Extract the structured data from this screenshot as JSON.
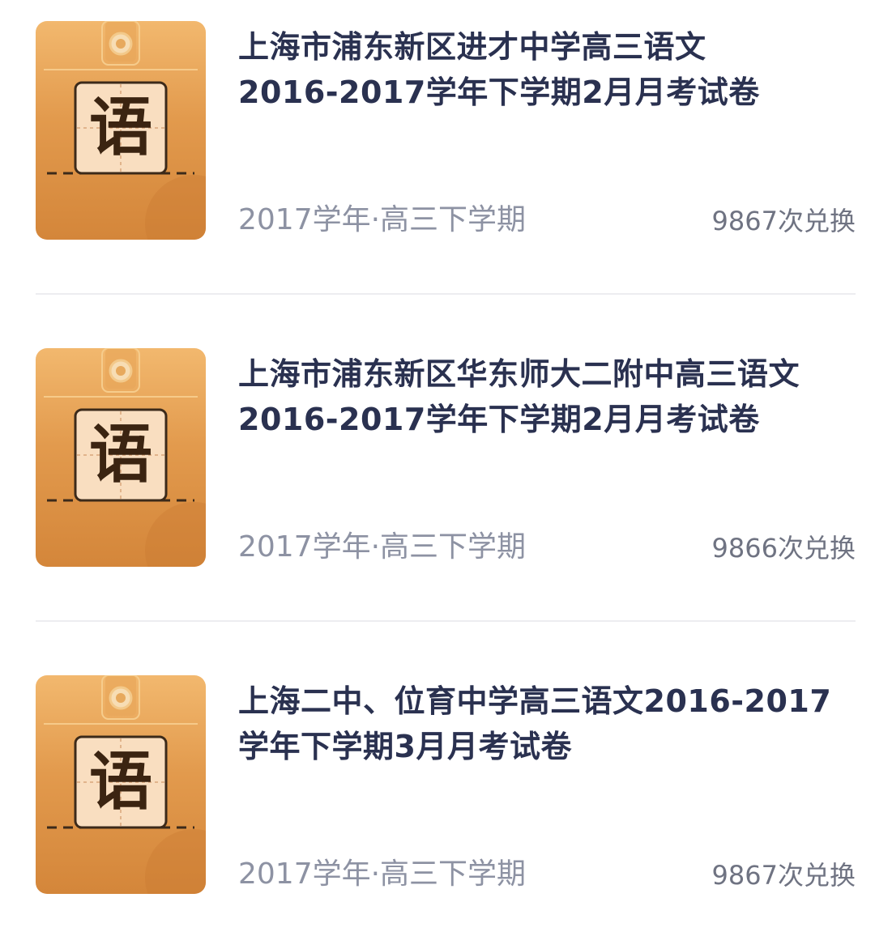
{
  "items": [
    {
      "title_line1": "上海市浦东新区进才中学高三语文",
      "title_line2": "2016-2017学年下学期2月月考试卷",
      "meta": "2017学年·高三下学期",
      "count": "9867次兑换",
      "cover_char": "语"
    },
    {
      "title_line1": "上海市浦东新区华东师大二附中高三语文",
      "title_line2": "2016-2017学年下学期2月月考试卷",
      "meta": "2017学年·高三下学期",
      "count": "9866次兑换",
      "cover_char": "语"
    },
    {
      "title_line1": "上海二中、位育中学高三语文2016-2017",
      "title_line2": "学年下学期3月月考试卷",
      "meta": "2017学年·高三下学期",
      "count": "9867次兑换",
      "cover_char": "语"
    }
  ],
  "colors": {
    "cover_top": "#F2B86E",
    "cover_bottom": "#D4863A",
    "title": "#2A3150",
    "meta": "#8D92A3",
    "divider": "#EDEDF0"
  },
  "icons": {
    "cover": "document-envelope-icon"
  }
}
